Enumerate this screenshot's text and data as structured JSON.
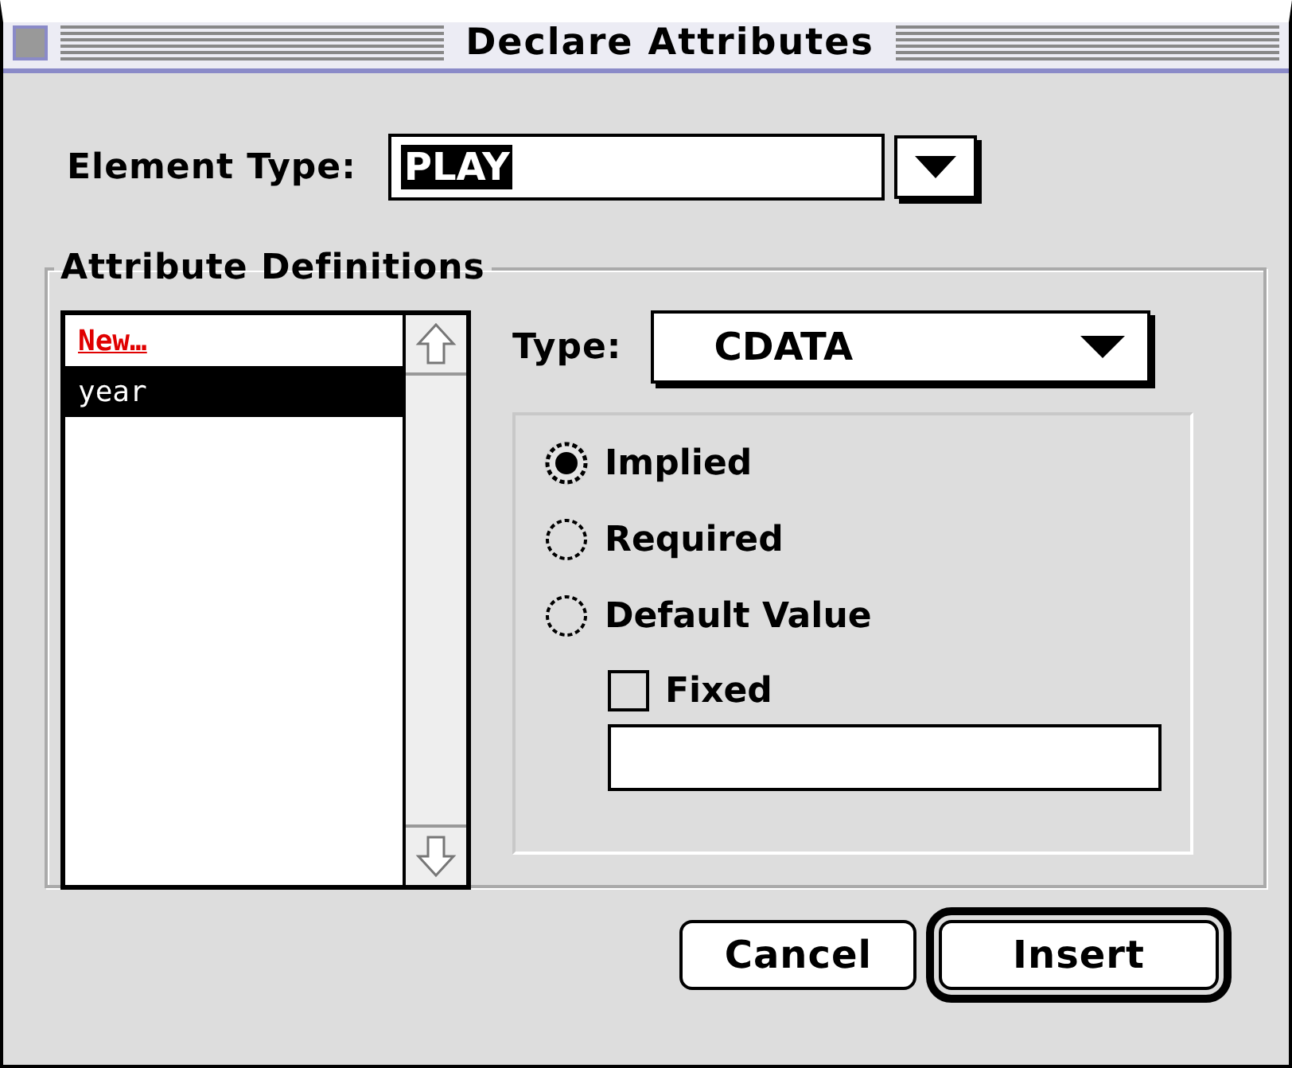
{
  "window": {
    "title": "Declare Attributes"
  },
  "element_type": {
    "label": "Element Type:",
    "value": "PLAY",
    "value_highlighted": true
  },
  "attribute_definitions": {
    "title": "Attribute Definitions",
    "items": [
      {
        "label": "New…",
        "kind": "new",
        "selected": false
      },
      {
        "label": "year",
        "kind": "item",
        "selected": true
      }
    ],
    "type": {
      "label": "Type:",
      "value": "CDATA"
    },
    "options": [
      {
        "label": "Implied",
        "selected": true
      },
      {
        "label": "Required",
        "selected": false
      },
      {
        "label": "Default Value",
        "selected": false
      }
    ],
    "fixed": {
      "label": "Fixed",
      "checked": false
    }
  },
  "buttons": [
    {
      "label": "Cancel",
      "default": false
    },
    {
      "label": "Insert",
      "default": true
    }
  ]
}
